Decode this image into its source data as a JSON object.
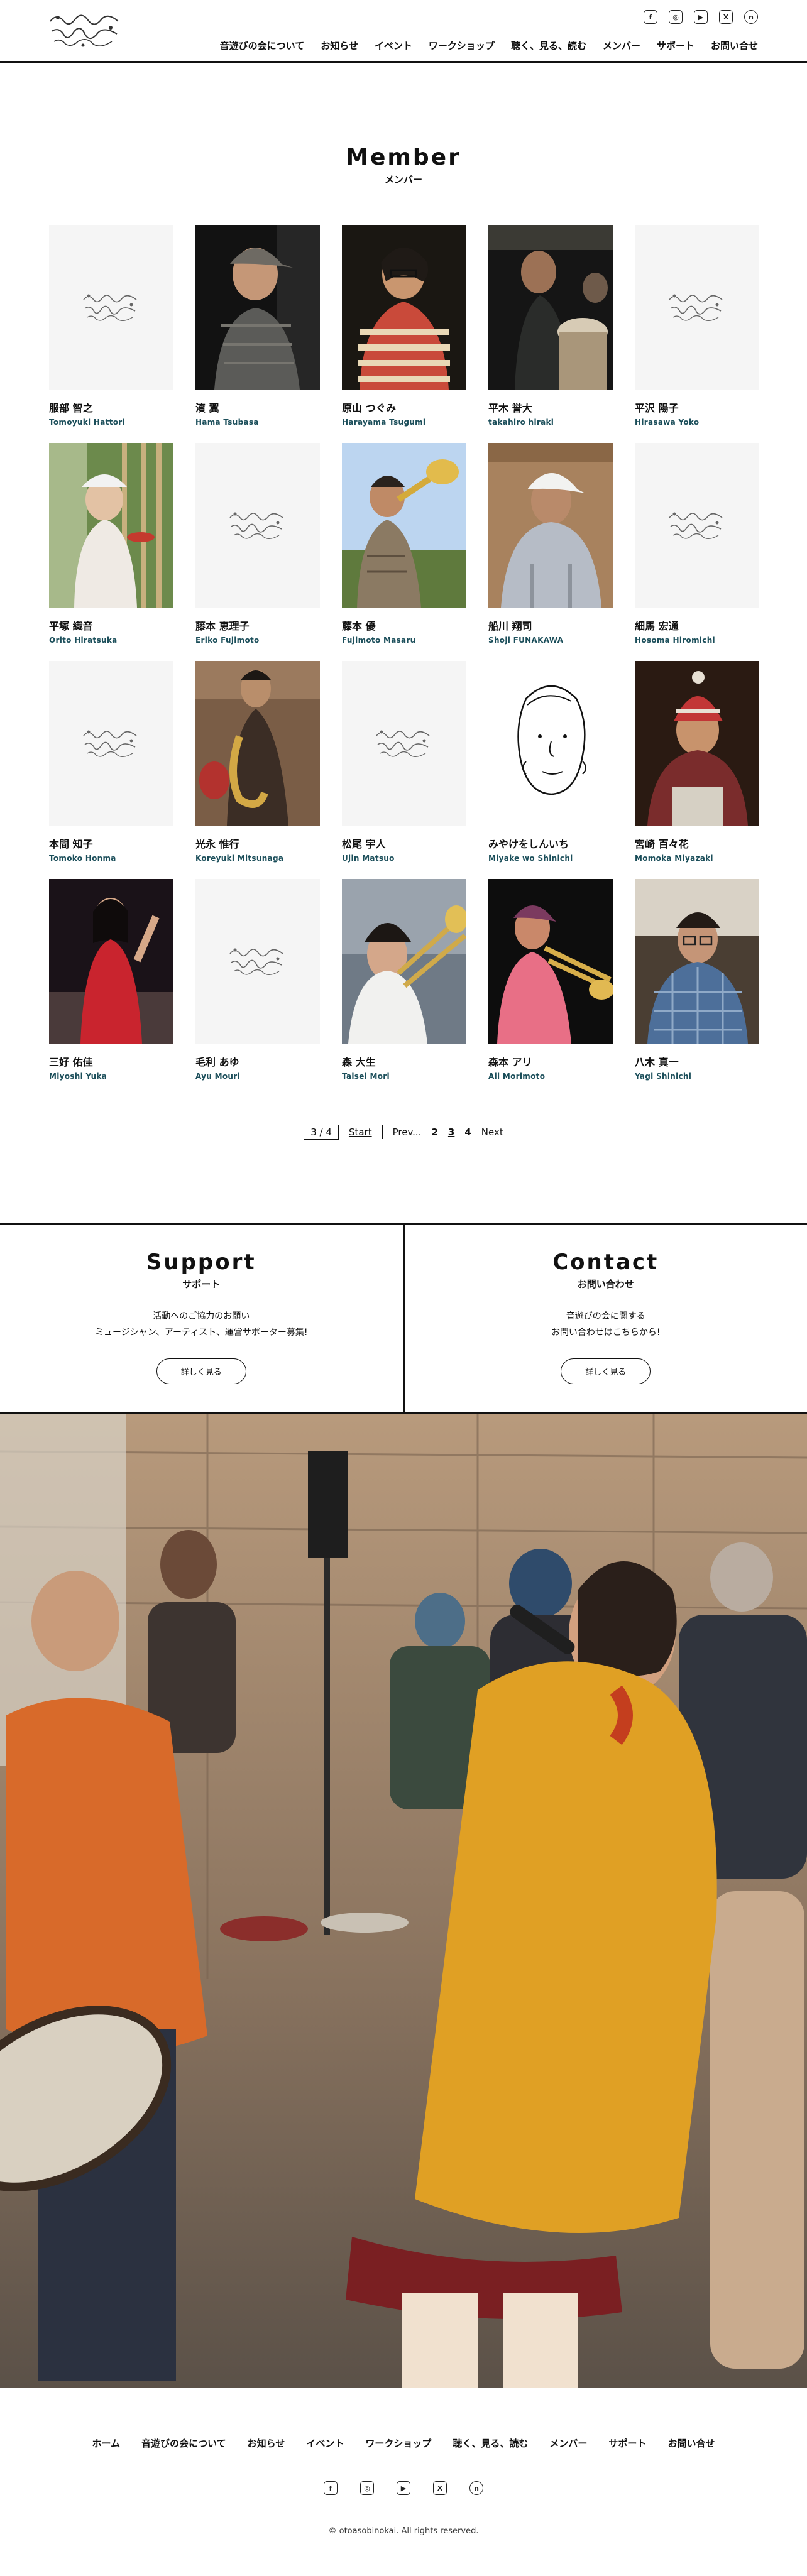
{
  "header": {
    "logo_alt": "音遊びの会",
    "nav": [
      "音遊びの会について",
      "お知らせ",
      "イベント",
      "ワークショップ",
      "聴く、見る、読む",
      "メンバー",
      "サポート",
      "お問い合せ"
    ],
    "social": [
      {
        "icon": "facebook-icon",
        "glyph": "f"
      },
      {
        "icon": "instagram-icon",
        "glyph": "◎"
      },
      {
        "icon": "youtube-icon",
        "glyph": "▶"
      },
      {
        "icon": "x-icon",
        "glyph": "X"
      },
      {
        "icon": "note-icon",
        "glyph": "n"
      }
    ]
  },
  "section": {
    "title": "Member",
    "subtitle": "メンバー"
  },
  "members": [
    {
      "name": "服部 智之",
      "roman": "Tomoyuki Hattori",
      "photo": "placeholder"
    },
    {
      "name": "濱 翼",
      "roman": "Hama Tsubasa",
      "photo": "cap-man-dark"
    },
    {
      "name": "原山 つぐみ",
      "roman": "Harayama Tsugumi",
      "photo": "striped-shirt"
    },
    {
      "name": "平木 誉大",
      "roman": "takahiro hiraki",
      "photo": "drummer"
    },
    {
      "name": "平沢 陽子",
      "roman": "Hirasawa Yoko",
      "photo": "placeholder"
    },
    {
      "name": "平塚 織音",
      "roman": "Orito Hiratsuka",
      "photo": "girl-hat"
    },
    {
      "name": "藤本 恵理子",
      "roman": "Eriko Fujimoto",
      "photo": "placeholder"
    },
    {
      "name": "藤本 優",
      "roman": "Fujimoto Masaru",
      "photo": "trumpet"
    },
    {
      "name": "船川 翔司",
      "roman": "Shoji FUNAKAWA",
      "photo": "white-cap"
    },
    {
      "name": "細馬 宏通",
      "roman": "Hosoma Hiromichi",
      "photo": "placeholder"
    },
    {
      "name": "本間 知子",
      "roman": "Tomoko Honma",
      "photo": "placeholder"
    },
    {
      "name": "光永 惟行",
      "roman": "Koreyuki Mitsunaga",
      "photo": "saxophone"
    },
    {
      "name": "松尾 宇人",
      "roman": "Ujin Matsuo",
      "photo": "placeholder"
    },
    {
      "name": "みやけをしんいち",
      "roman": "Miyake wo Shinichi",
      "photo": "drawing"
    },
    {
      "name": "宮崎 百々花",
      "roman": "Momoka Miyazaki",
      "photo": "knit-hat"
    },
    {
      "name": "三好 佑佳",
      "roman": "Miyoshi Yuka",
      "photo": "red-dancer"
    },
    {
      "name": "毛利 あゆ",
      "roman": "Ayu Mouri",
      "photo": "placeholder"
    },
    {
      "name": "森 大生",
      "roman": "Taisei Mori",
      "photo": "trombone-boy"
    },
    {
      "name": "森本 アリ",
      "roman": "Ali Morimoto",
      "photo": "trombone-man"
    },
    {
      "name": "八木 真一",
      "roman": "Yagi Shinichi",
      "photo": "glasses-man"
    }
  ],
  "pagination": {
    "status": "3 / 4",
    "start": "Start",
    "prev": "Prev...",
    "pages": [
      "2",
      "3",
      "4"
    ],
    "current": "3",
    "next": "Next"
  },
  "support": {
    "title": "Support",
    "subtitle": "サポート",
    "line1": "活動へのご協力のお願い",
    "line2": "ミュージシャン、アーティスト、運営サポーター募集!",
    "button": "詳しく見る"
  },
  "contact": {
    "title": "Contact",
    "subtitle": "お問い合わせ",
    "line1": "音遊びの会に関する",
    "line2": "お問い合わせはこちらから!",
    "button": "詳しく見る"
  },
  "footer": {
    "nav": [
      "ホーム",
      "音遊びの会について",
      "お知らせ",
      "イベント",
      "ワークショップ",
      "聴く、見る、読む",
      "メンバー",
      "サポート",
      "お問い合せ"
    ],
    "copyright": "© otoasobinokai. All rights reserved."
  }
}
